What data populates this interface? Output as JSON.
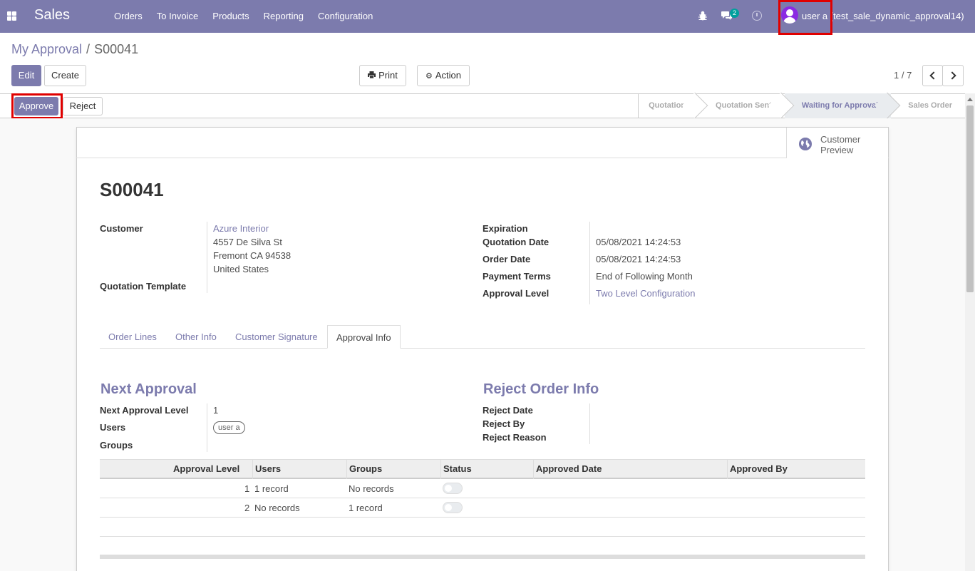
{
  "navbar": {
    "brand": "Sales",
    "menu": [
      "Orders",
      "To Invoice",
      "Products",
      "Reporting",
      "Configuration"
    ],
    "chat_badge": "2",
    "user": "user a (test_sale_dynamic_approval14)"
  },
  "breadcrumb": {
    "parent": "My Approval",
    "separator": "/",
    "current": "S00041"
  },
  "buttons": {
    "edit": "Edit",
    "create": "Create",
    "print": "Print",
    "action": "Action",
    "approve": "Approve",
    "reject": "Reject",
    "customer_preview": "Customer Preview"
  },
  "pager": {
    "value": "1 / 7"
  },
  "stages": [
    "Quotation",
    "Quotation Sent",
    "Waiting for Approval",
    "Sales Order"
  ],
  "active_stage": "Waiting for Approval",
  "record": {
    "name": "S00041",
    "customer_label": "Customer",
    "customer_name": "Azure Interior",
    "customer_street": "4557 De Silva St",
    "customer_city": "Fremont CA 94538",
    "customer_country": "United States",
    "quotation_template_label": "Quotation Template",
    "expiration_label": "Expiration",
    "quotation_date_label": "Quotation Date",
    "quotation_date": "05/08/2021 14:24:53",
    "order_date_label": "Order Date",
    "order_date": "05/08/2021 14:24:53",
    "payment_terms_label": "Payment Terms",
    "payment_terms": "End of Following Month",
    "approval_level_label": "Approval Level",
    "approval_level": "Two Level Configuration"
  },
  "tabs": [
    "Order Lines",
    "Other Info",
    "Customer Signature",
    "Approval Info"
  ],
  "active_tab": "Approval Info",
  "approval": {
    "next_title": "Next Approval",
    "next_level_label": "Next Approval Level",
    "next_level": "1",
    "users_label": "Users",
    "users_tag": "user a",
    "groups_label": "Groups",
    "reject_title": "Reject Order Info",
    "reject_date_label": "Reject Date",
    "reject_by_label": "Reject By",
    "reject_reason_label": "Reject Reason"
  },
  "table": {
    "headers": [
      "Approval Level",
      "Users",
      "Groups",
      "Status",
      "Approved Date",
      "Approved By"
    ],
    "rows": [
      {
        "level": "1",
        "users": "1 record",
        "groups": "No records",
        "status": false
      },
      {
        "level": "2",
        "users": "No records",
        "groups": "1 record",
        "status": false
      }
    ]
  },
  "colors": {
    "brand": "#7c7bad",
    "highlight": "#e00000",
    "badge": "#00a09d"
  }
}
